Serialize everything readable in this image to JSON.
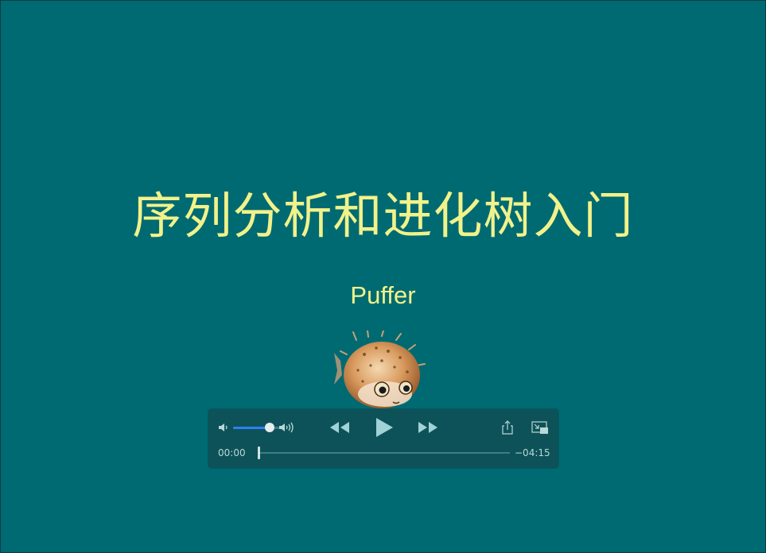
{
  "slide": {
    "title": "序列分析和进化树入门",
    "subtitle": "Puffer",
    "mascot_icon": "pufferfish-image"
  },
  "player": {
    "elapsed": "00:00",
    "remaining": "−04:15",
    "progress_fraction": 0.0,
    "volume_fraction": 0.82,
    "icons": {
      "volume_low": "speaker-low-icon",
      "volume_high": "speaker-high-icon",
      "rewind": "rewind-icon",
      "play": "play-icon",
      "fast_forward": "fast-forward-icon",
      "share": "share-icon",
      "pip": "picture-in-picture-icon"
    }
  },
  "colors": {
    "background": "#006a72",
    "title_text": "#f2f28a",
    "controls_bg": "#0d5258",
    "volume_accent": "#2f7ff5"
  }
}
